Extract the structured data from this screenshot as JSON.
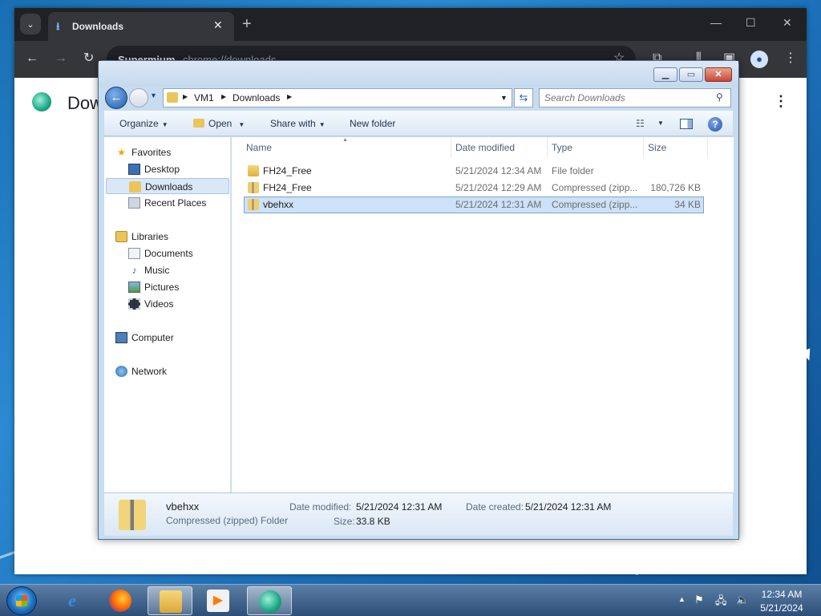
{
  "browser": {
    "tab_title": "Downloads",
    "omnibox_brand": "Supermium",
    "omnibox_url": "chrome://downloads",
    "page_heading": "Downloads"
  },
  "explorer": {
    "breadcrumbs": [
      "VM1",
      "Downloads"
    ],
    "search_placeholder": "Search Downloads",
    "commands": {
      "organize": "Organize",
      "open": "Open",
      "share_with": "Share with",
      "new_folder": "New folder"
    },
    "nav": {
      "favorites": "Favorites",
      "desktop": "Desktop",
      "downloads": "Downloads",
      "recent_places": "Recent Places",
      "libraries": "Libraries",
      "documents": "Documents",
      "music": "Music",
      "pictures": "Pictures",
      "videos": "Videos",
      "computer": "Computer",
      "network": "Network"
    },
    "columns": {
      "name": "Name",
      "date_modified": "Date modified",
      "type": "Type",
      "size": "Size"
    },
    "files": [
      {
        "name": "FH24_Free",
        "date": "5/21/2024 12:34 AM",
        "type": "File folder",
        "size": "",
        "kind": "folder"
      },
      {
        "name": "FH24_Free",
        "date": "5/21/2024 12:29 AM",
        "type": "Compressed (zipp...",
        "size": "180,726 KB",
        "kind": "zip"
      },
      {
        "name": "vbehxx",
        "date": "5/21/2024 12:31 AM",
        "type": "Compressed (zipp...",
        "size": "34 KB",
        "kind": "zip",
        "selected": true
      }
    ],
    "details": {
      "name": "vbehxx",
      "type": "Compressed (zipped) Folder",
      "date_modified_label": "Date modified:",
      "date_modified": "5/21/2024 12:31 AM",
      "date_created_label": "Date created:",
      "date_created": "5/21/2024 12:31 AM",
      "size_label": "Size:",
      "size": "33.8 KB"
    }
  },
  "taskbar": {
    "clock_time": "12:34 AM",
    "clock_date": "5/21/2024"
  }
}
